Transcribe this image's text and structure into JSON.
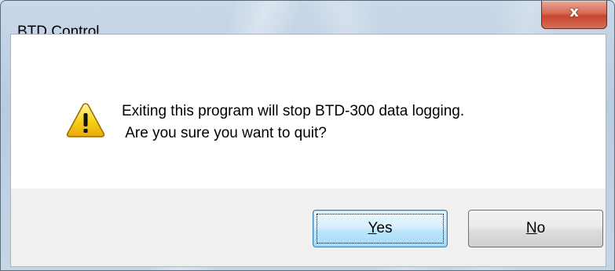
{
  "window": {
    "title": "BTD Control",
    "close_glyph": "x"
  },
  "dialog": {
    "icon": "warning-icon",
    "message_line1": "Exiting this program will stop BTD-300 data logging.",
    "message_line2": " Are you sure you want to quit?"
  },
  "buttons": {
    "yes": {
      "accel": "Y",
      "rest": "es"
    },
    "no": {
      "accel": "N",
      "rest": "o"
    }
  },
  "colors": {
    "close_button": "#c8452c",
    "default_button_border": "#3c7fb1",
    "warning_fill": "#f7d21b"
  }
}
